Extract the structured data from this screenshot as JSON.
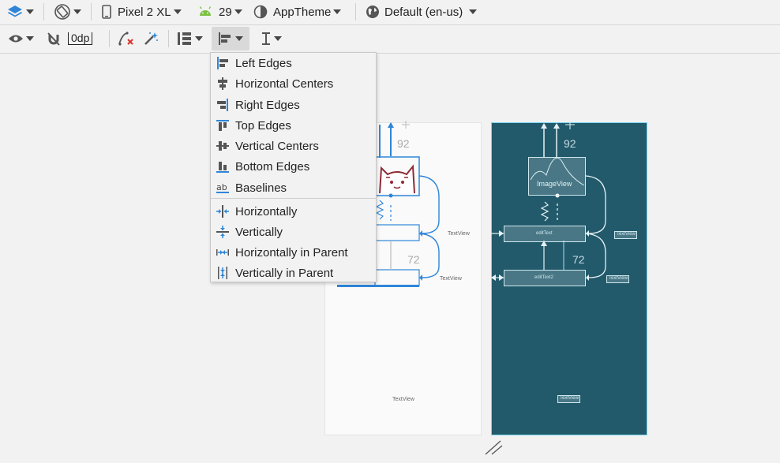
{
  "toolbar": {
    "device": "Pixel 2 XL",
    "api_level": "29",
    "theme": "AppTheme",
    "locale": "Default (en-us)",
    "default_margin": "0dp"
  },
  "menu": {
    "align_items": [
      "Left Edges",
      "Horizontal Centers",
      "Right Edges",
      "Top Edges",
      "Vertical Centers",
      "Bottom Edges",
      "Baselines"
    ],
    "center_items": [
      "Horizontally",
      "Vertically",
      "Horizontally in Parent",
      "Vertically in Parent"
    ]
  },
  "design": {
    "dim_top": "92",
    "dim_mid": "72",
    "textview_1": "TextView",
    "textview_2": "TextView",
    "textview_bottom": "TextView"
  },
  "blueprint": {
    "dim_top": "92",
    "dim_mid": "72",
    "imageview": "ImageView",
    "edittext_1": "editText",
    "edittext_2": "editText2",
    "textview_1": "TextView",
    "textview_2": "TextView",
    "textview_bottom": "TextView"
  },
  "colors": {
    "accent_blue": "#2f86d8",
    "blueprint_bg": "#225a6b",
    "android_green": "#7cc242"
  }
}
